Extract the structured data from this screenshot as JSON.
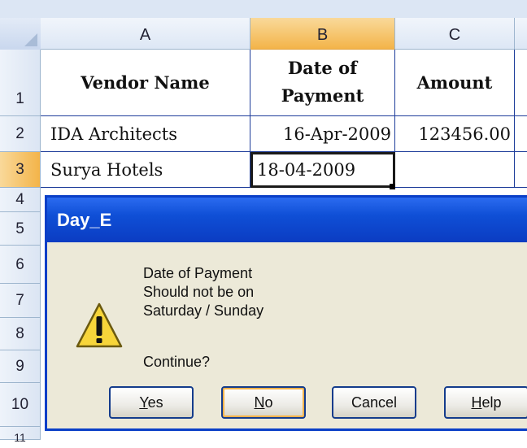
{
  "columns": [
    "A",
    "B",
    "C"
  ],
  "rows": [
    "1",
    "2",
    "3",
    "4",
    "5",
    "6",
    "7",
    "8",
    "9",
    "10",
    "11"
  ],
  "table": {
    "header": {
      "a": "Vendor Name",
      "b_line1": "Date of",
      "b_line2": "Payment",
      "c": "Amount"
    },
    "row2": {
      "a": "IDA Architects",
      "b": "16-Apr-2009",
      "c": "123456.00"
    },
    "row3": {
      "a": "Surya Hotels",
      "b": "18-04-2009",
      "c": ""
    }
  },
  "dialog": {
    "title": "Day_E",
    "message": [
      "Date of Payment",
      "Should not be on",
      "Saturday / Sunday"
    ],
    "prompt": "Continue?",
    "buttons": {
      "yes": {
        "mnemonic": "Y",
        "rest": "es"
      },
      "no": {
        "mnemonic": "N",
        "rest": "o"
      },
      "cancel": "Cancel",
      "help": {
        "mnemonic": "H",
        "rest": "elp"
      }
    },
    "icon": "warning-icon"
  },
  "colors": {
    "accent": "#0a3fc7",
    "selected_header": "#f3b449",
    "grid": "#1e3d9a"
  }
}
